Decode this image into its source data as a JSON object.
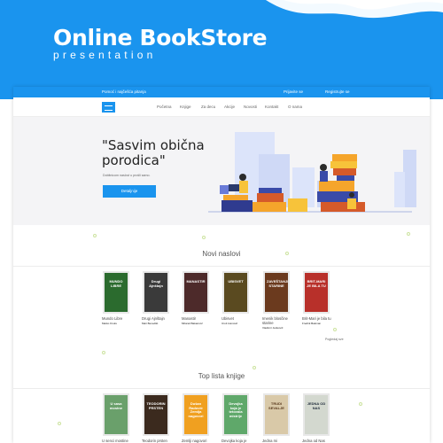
{
  "header": {
    "title": "Online BookStore",
    "subtitle": "presentation"
  },
  "topbar": {
    "help": "Pomoć i najčešća pitanja",
    "login": "Prijavite se",
    "register": "Registrujte se"
  },
  "nav": {
    "items": [
      "Početna",
      "Knjige",
      "Za decu",
      "Akcije",
      "Novosti",
      "Kontakt",
      "O nama"
    ]
  },
  "hero": {
    "title": "\"Sasvim obična porodica\"",
    "description": "Dobitnicom naslovi u prošli samo.",
    "button": "Detaljnije"
  },
  "new_titles": {
    "heading": "Novi naslovi",
    "more": "Pogledaj sve",
    "books": [
      {
        "cover": "MUNDO LIBRE",
        "title": "Mundo Libre",
        "author": "Marko Kruks",
        "color": "#2b6b2e"
      },
      {
        "cover": "Drugi Ajnštajn",
        "title": "Drugi Ajnštajn",
        "author": "Mari Benedikt",
        "color": "#3a3a3a"
      },
      {
        "cover": "MANASTIR",
        "title": "Manastir",
        "author": "Milorad Bakarović",
        "color": "#4d2a2a"
      },
      {
        "cover": "UBISVET",
        "title": "Ubisvet",
        "author": "Uroš Ivanović",
        "color": "#5a4a20"
      },
      {
        "cover": "ZAVEŠTANJE STARINE",
        "title": "Imenik blosčine starine",
        "author": "Vladimir Jankovič",
        "color": "#6b3a1e"
      },
      {
        "cover": "BRIT-MARI JE BILA TU",
        "title": "Brit-Mari je bila tu",
        "author": "Fredrik Bakman",
        "color": "#b8302a"
      }
    ]
  },
  "top_list": {
    "heading": "Top lista knjige",
    "books": [
      {
        "cover": "U sasa mostne",
        "title": "U senci mostine",
        "color": "#6aa06b"
      },
      {
        "cover": "TEODORIN PRSTEN",
        "title": "Teodorin prsten",
        "color": "#3b2a1e"
      },
      {
        "cover": "Dušan Radović Zemlja nagovori",
        "title": "Zemlji nagovori",
        "color": "#f0a020"
      },
      {
        "cover": "Devojka koja je tetovala mistrije",
        "title": "Devojka koja je",
        "color": "#5fa86a"
      },
      {
        "cover": "TRUDI SEVALJE",
        "title": "Jedna mi",
        "color": "#d9c9a8"
      },
      {
        "cover": "JEDNA OD NAS",
        "title": "Jedna od Nas",
        "color": "#d3d8cf"
      }
    ]
  }
}
